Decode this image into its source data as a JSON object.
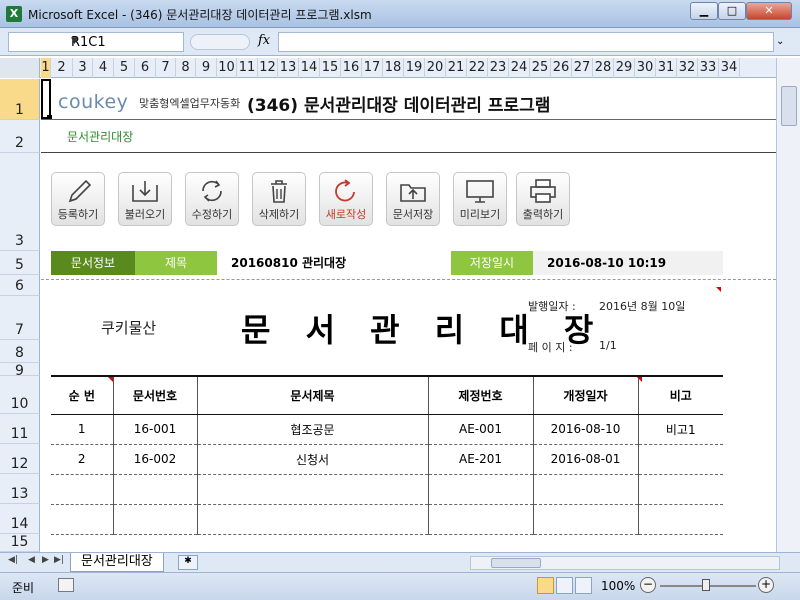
{
  "window": {
    "title": "Microsoft Excel - (346) 문서관리대장 데이터관리 프로그램.xlsm",
    "min": "▁",
    "max": "□",
    "close": "✕"
  },
  "formula_bar": {
    "name_box": "R1C1",
    "fx": "fx",
    "formula": ""
  },
  "columns": [
    "1",
    "2",
    "3",
    "4",
    "5",
    "6",
    "7",
    "8",
    "9",
    "10",
    "11",
    "12",
    "13",
    "14",
    "15",
    "16",
    "17",
    "18",
    "19",
    "20",
    "21",
    "22",
    "23",
    "24",
    "25",
    "26",
    "27",
    "28",
    "29",
    "30",
    "31",
    "32",
    "33",
    "34"
  ],
  "rows": [
    "1",
    "2",
    "3",
    "5",
    "6",
    "7",
    "8",
    "9",
    "10",
    "11",
    "12",
    "13",
    "14",
    "15"
  ],
  "header": {
    "logo_text": "coukey",
    "slogan": "맞춤형엑셀업무자동화",
    "app_title": "(346) 문서관리대장 데이터관리 프로그램",
    "sub_title": "문서관리대장"
  },
  "toolbar": [
    {
      "label": "등록하기",
      "icon": "pencil-icon"
    },
    {
      "label": "불러오기",
      "icon": "download-icon"
    },
    {
      "label": "수정하기",
      "icon": "refresh-icon"
    },
    {
      "label": "삭제하기",
      "icon": "trash-icon"
    },
    {
      "label": "새로작성",
      "icon": "new-icon"
    },
    {
      "label": "문서저장",
      "icon": "upload-icon"
    },
    {
      "label": "미리보기",
      "icon": "monitor-icon"
    },
    {
      "label": "출력하기",
      "icon": "printer-icon"
    }
  ],
  "info": {
    "doc_info_label": "문서정보",
    "title_label": "제목",
    "title_value": "20160810 관리대장",
    "saved_label": "저장일시",
    "saved_value": "2016-08-10 10:19"
  },
  "document": {
    "company": "쿠키물산",
    "main_title": "문 서 관 리 대 장",
    "issue_date_label": "발행일자 :",
    "issue_date_value": "2016년 8월 10일",
    "page_label": "페 이 지 :",
    "page_value": "1/1"
  },
  "table": {
    "headers": [
      "순 번",
      "문서번호",
      "문서제목",
      "제정번호",
      "개정일자",
      "비고"
    ],
    "rows": [
      [
        "1",
        "16-001",
        "협조공문",
        "AE-001",
        "2016-08-10",
        "비고1"
      ],
      [
        "2",
        "16-002",
        "신청서",
        "AE-201",
        "2016-08-01",
        ""
      ],
      [
        "",
        "",
        "",
        "",
        "",
        ""
      ],
      [
        "",
        "",
        "",
        "",
        "",
        ""
      ]
    ]
  },
  "tabs": {
    "sheet_name": "문서관리대장"
  },
  "status": {
    "ready": "준비",
    "zoom": "100%",
    "zoom_minus": "−",
    "zoom_plus": "+"
  },
  "colors": {
    "dark_green": "#5a8a1e",
    "light_green": "#8ec63f",
    "sub_title_green": "#2e8b2e",
    "selection": "#f9d98a"
  }
}
